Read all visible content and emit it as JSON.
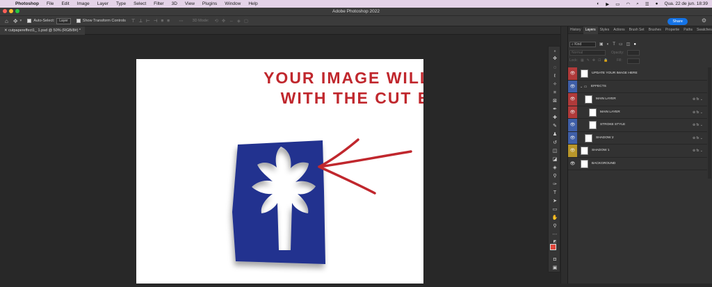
{
  "menubar": {
    "app": "Photoshop",
    "items": [
      "File",
      "Edit",
      "Image",
      "Layer",
      "Type",
      "Select",
      "Filter",
      "3D",
      "View",
      "Plugins",
      "Window",
      "Help"
    ],
    "datetime": "Qua. 22 de jun.  18:39"
  },
  "window": {
    "title": "Adobe Photoshop 2022"
  },
  "options": {
    "auto_select_label": "Auto-Select:",
    "auto_select_value": "Layer",
    "show_transform_label": "Show Transform Controls",
    "mode_3d_label": "3D Mode:",
    "share_label": "Share"
  },
  "document": {
    "tab_title": "cutpapereffect1_ 1.psd @ 50% (RGB/8#) *",
    "headline_line1": "YOUR IMAGE WILL APPEAR",
    "headline_line2": "WITH THE CUT EFFECT"
  },
  "panel": {
    "tabs": [
      "History",
      "Layers",
      "Styles",
      "Actions",
      "Brush Set",
      "Brushes",
      "Propertie",
      "Paths",
      "Swatches"
    ],
    "active_tab": "Layers",
    "filter_kind": "Kind",
    "blend_mode": "Normal",
    "opacity_label": "Opacity:",
    "lock_label": "Lock:",
    "fill_label": "Fill:"
  },
  "layers": [
    {
      "name": "UPDATE YOUR IMAGE HERE",
      "color": "#b03a3a",
      "indent": 0,
      "fx": false
    },
    {
      "name": "EFFECTS",
      "color": "#3f5fa8",
      "indent": 0,
      "group": true,
      "fx": false
    },
    {
      "name": "MAIN LAYER",
      "color": "#b03a3a",
      "indent": 1,
      "fx": true
    },
    {
      "name": "MAIN LAYER",
      "color": "#b03a3a",
      "indent": 2,
      "fx": true
    },
    {
      "name": "STROKE STYLE",
      "color": "#3f5fa8",
      "indent": 2,
      "fx": true
    },
    {
      "name": "SHADOW 2",
      "color": "#3f5fa8",
      "indent": 1,
      "fx": true
    },
    {
      "name": "SHADOW 1",
      "color": "#b8962a",
      "indent": 0,
      "fx": true
    },
    {
      "name": "BACKGROUND",
      "color": "#323232",
      "indent": 0,
      "fx": false
    }
  ],
  "colors": {
    "headline": "#c0272d",
    "shape_blue": "#21338f",
    "share_blue": "#1473e6",
    "foreground": "#e0453a"
  }
}
